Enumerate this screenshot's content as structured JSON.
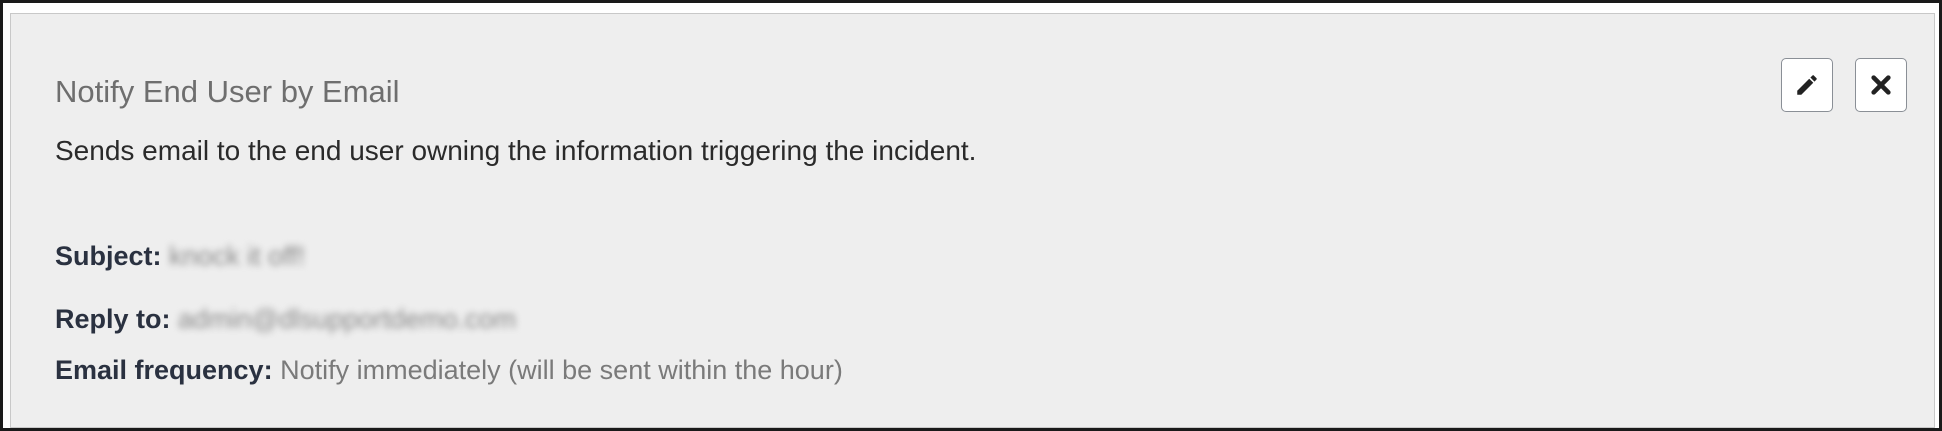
{
  "card": {
    "title": "Notify End User by Email",
    "description": "Sends email to the end user owning the information triggering the incident.",
    "fields": {
      "subject": {
        "label": "Subject:",
        "value": "knock it off!"
      },
      "reply_to": {
        "label": "Reply to:",
        "value": "admin@dlsupportdemo.com"
      },
      "email_frequency": {
        "label": "Email frequency:",
        "value": "Notify immediately (will be sent within the hour)"
      }
    }
  },
  "actions": {
    "edit_icon": "pencil-icon",
    "remove_icon": "close-icon"
  },
  "colors": {
    "panel_background": "#eeeeee",
    "label_text": "#2a3140",
    "value_text": "#7a7a7a"
  }
}
